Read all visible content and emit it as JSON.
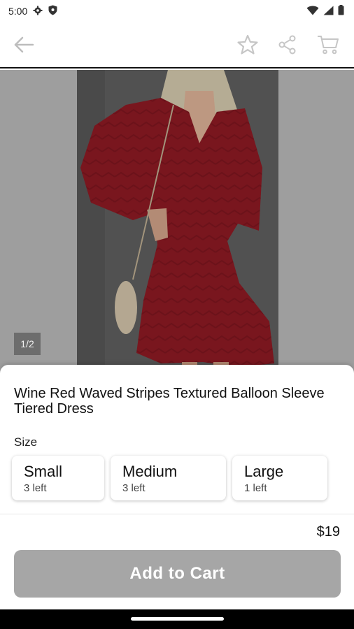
{
  "status_bar": {
    "time": "5:00",
    "icons": [
      "settings-icon",
      "shield-icon",
      "wifi-icon",
      "signal-icon",
      "battery-icon"
    ]
  },
  "toolbar": {
    "icons": [
      "back-arrow-icon",
      "star-icon",
      "share-icon",
      "cart-icon"
    ]
  },
  "gallery": {
    "pager": "1/2"
  },
  "product": {
    "title": "Wine Red Waved Stripes Textured Balloon Sleeve Tiered Dress",
    "size_label": "Size",
    "sizes": [
      {
        "name": "Small",
        "stock": "3 left"
      },
      {
        "name": "Medium",
        "stock": "3 left"
      },
      {
        "name": "Large",
        "stock": "1 left"
      }
    ],
    "price": "$19",
    "add_to_cart": "Add to Cart"
  },
  "colors": {
    "dress": "#8a1a23",
    "button_disabled": "#a6a6a6"
  }
}
